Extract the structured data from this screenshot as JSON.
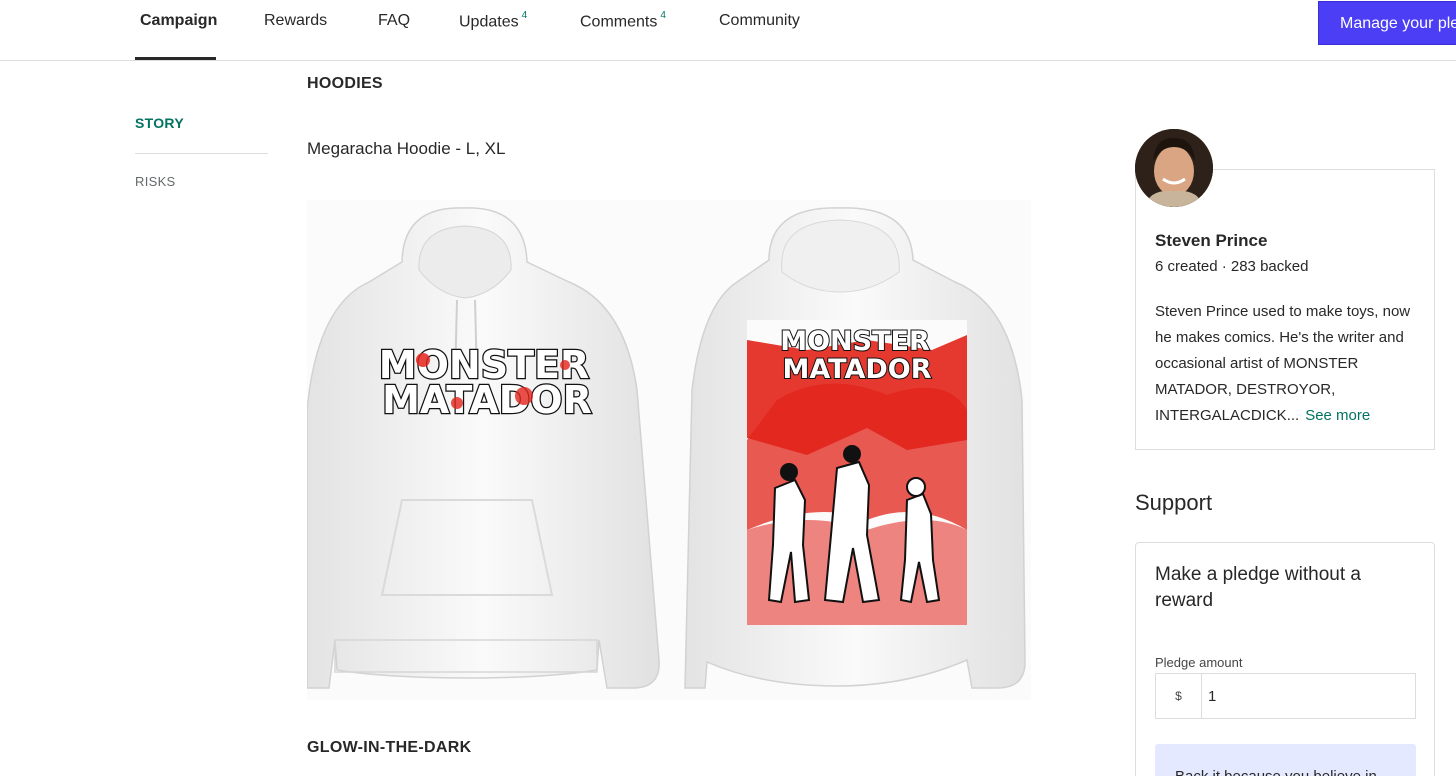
{
  "nav": {
    "tabs": [
      {
        "label": "Campaign",
        "count": ""
      },
      {
        "label": "Rewards",
        "count": ""
      },
      {
        "label": "FAQ",
        "count": ""
      },
      {
        "label": "Updates",
        "count": "4"
      },
      {
        "label": "Comments",
        "count": "4"
      },
      {
        "label": "Community",
        "count": ""
      }
    ],
    "manage_button": "Manage your pledge"
  },
  "sidenav": {
    "story": "STORY",
    "risks": "RISKS"
  },
  "content": {
    "hoodies_heading": "HOODIES",
    "item_title": "Megaracha Hoodie - L, XL",
    "front_print": [
      "MONSTER",
      "MATADOR"
    ],
    "back_print": [
      "MONSTER",
      "MATADOR"
    ],
    "glow_heading": "GLOW-IN-THE-DARK"
  },
  "creator": {
    "name": "Steven Prince",
    "stats": "6 created · 283 backed",
    "bio": "Steven Prince used to make toys, now he makes comics. He's the writer and occasional artist of MONSTER MATADOR, DESTROYOR, INTERGALACDICK...",
    "see_more": "See more"
  },
  "support": {
    "heading": "Support",
    "pledge_title": "Make a pledge without a reward",
    "pledge_label": "Pledge amount",
    "currency": "$",
    "amount": "1",
    "back_note": "Back it because you believe in"
  },
  "colors": {
    "accent_green": "#037362",
    "button_purple": "#4b3ef5",
    "note_bg": "#e5e9ff",
    "print_red": "#e2231a"
  }
}
